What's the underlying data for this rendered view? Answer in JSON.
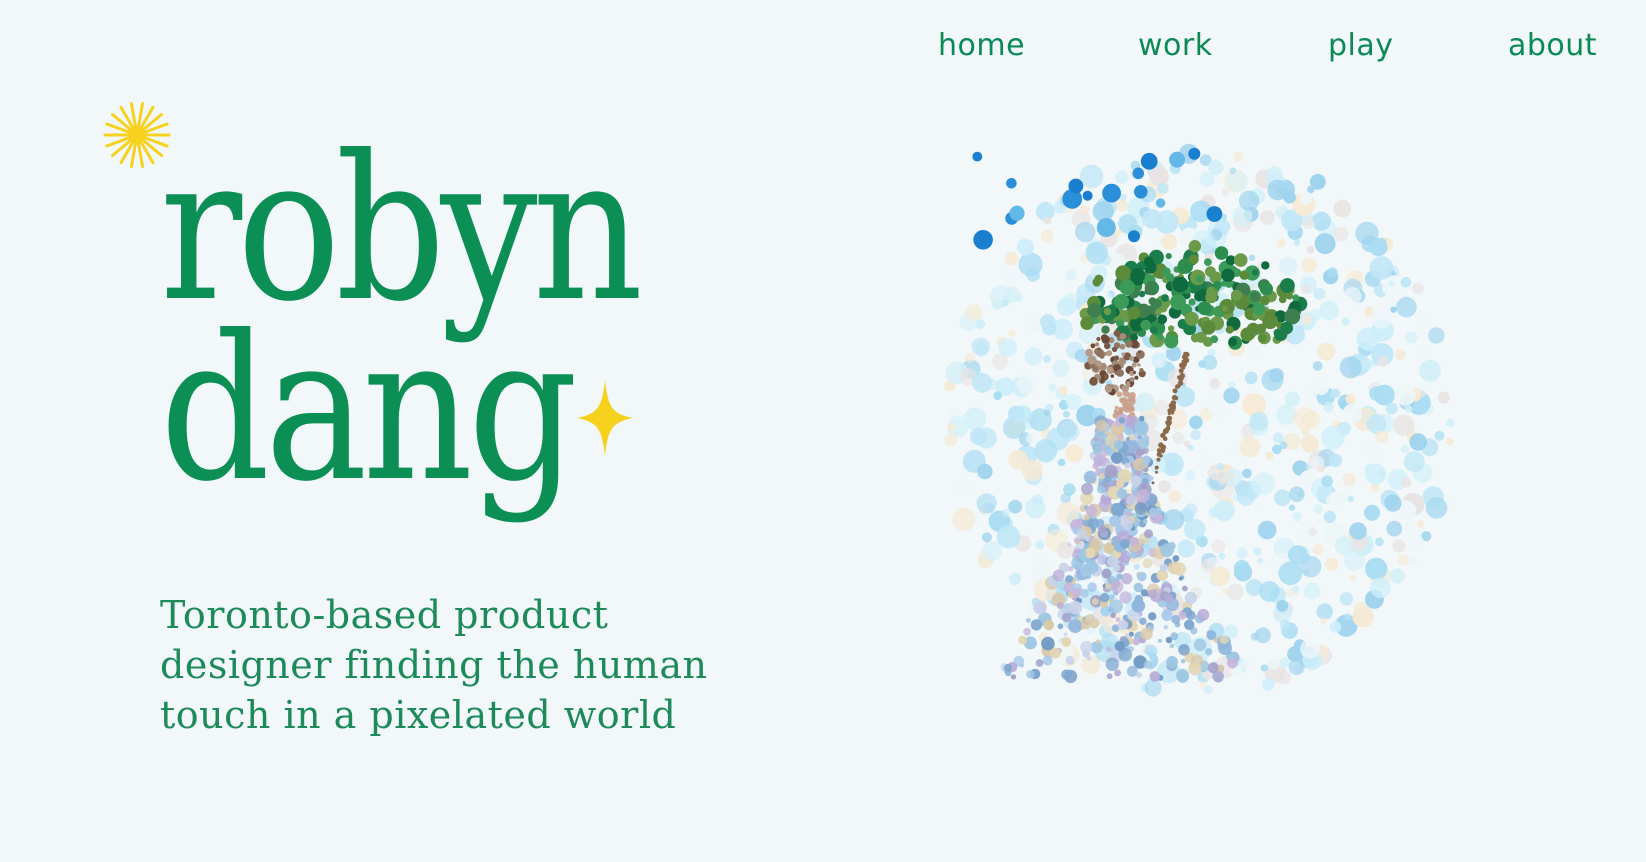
{
  "nav": {
    "items": [
      "home",
      "work",
      "play",
      "about"
    ]
  },
  "hero": {
    "name_line_1": "robyn",
    "name_line_2": "dang",
    "tagline": "Toronto-based product designer finding the human touch in a pixelated world"
  },
  "colors": {
    "background": "#f2f8fa",
    "brand_green": "#0b8f55",
    "accent_yellow": "#f6d21e"
  },
  "illustration": {
    "icon": "pixelated-umbrella-portrait"
  }
}
